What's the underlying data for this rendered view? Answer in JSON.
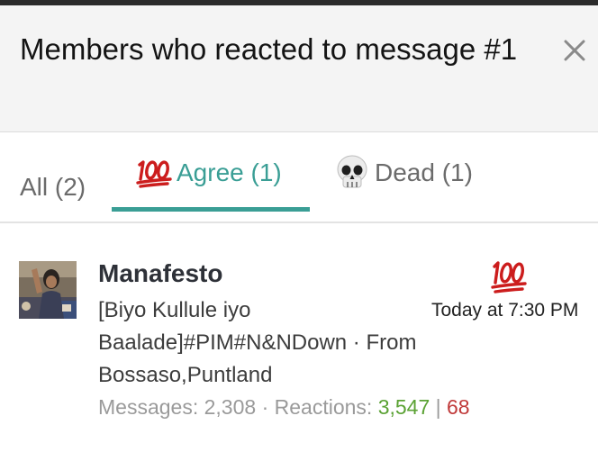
{
  "dialog": {
    "title": "Members who reacted to message #1"
  },
  "tabs": [
    {
      "label": "All (2)",
      "icon": null,
      "active": false
    },
    {
      "label": "Agree (1)",
      "icon": "hundred-points-icon",
      "active": true
    },
    {
      "label": "Dead (1)",
      "icon": "skull-icon",
      "active": false
    }
  ],
  "member": {
    "name": "Manafesto",
    "title_lines": [
      "[Biyo Kullule iyo",
      "Baalade]#PIM#N&NDown · From",
      "Bossaso,Puntland"
    ],
    "time": "Today at 7:30 PM",
    "reaction_icon": "hundred-points-icon",
    "stats": {
      "messages_label": "Messages:",
      "messages": "2,308",
      "dot": "·",
      "reactions_label": "Reactions:",
      "reactions_positive": "3,547",
      "divider": "|",
      "reactions_negative": "68"
    }
  },
  "colors": {
    "accent": "#3a9e95",
    "positive": "#5ba234",
    "negative": "#c03a3a",
    "emoji_red": "#cc1d1d"
  }
}
